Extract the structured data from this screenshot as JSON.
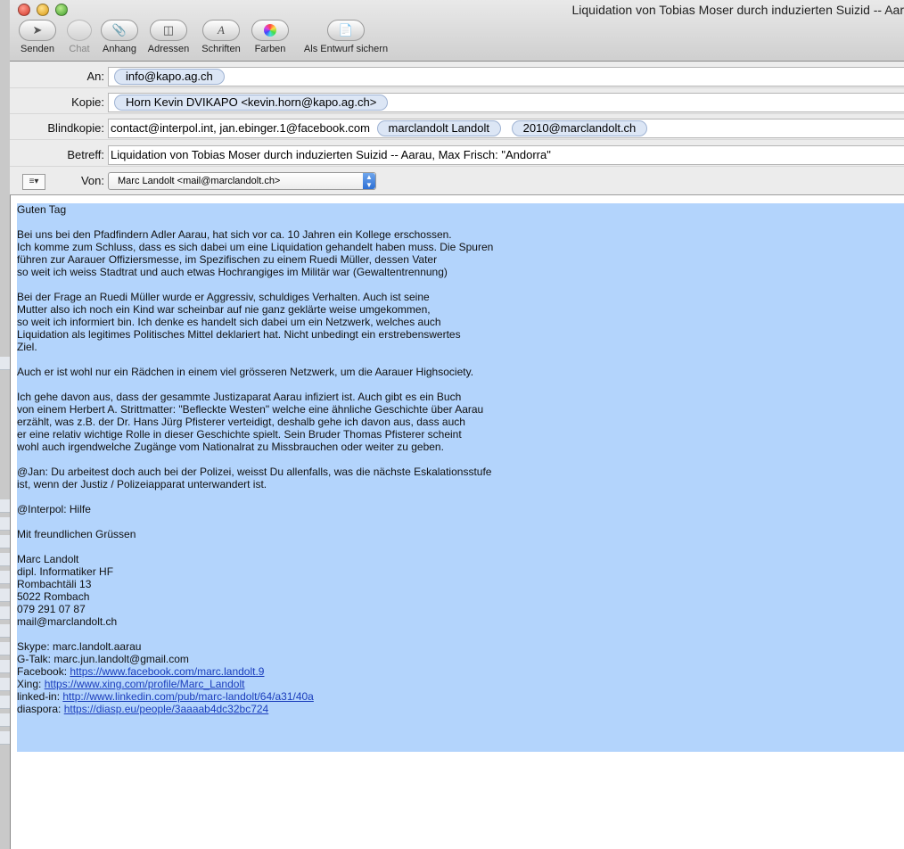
{
  "window": {
    "title": "Liquidation von Tobias Moser durch induzierten Suizid -- Aar"
  },
  "toolbar": {
    "items": [
      {
        "label": "Senden",
        "icon": "send-icon"
      },
      {
        "label": "Chat",
        "icon": "chat-icon"
      },
      {
        "label": "Anhang",
        "icon": "paperclip-icon"
      },
      {
        "label": "Adressen",
        "icon": "address-book-icon"
      },
      {
        "label": "Schriften",
        "icon": "font-icon"
      },
      {
        "label": "Farben",
        "icon": "color-wheel-icon"
      },
      {
        "label": "Als Entwurf sichern",
        "icon": "draft-icon"
      }
    ]
  },
  "header": {
    "an_label": "An:",
    "an_tokens": [
      "info@kapo.ag.ch"
    ],
    "kopie_label": "Kopie:",
    "kopie_tokens": [
      "Horn Kevin DVIKAPO <kevin.horn@kapo.ag.ch>"
    ],
    "blind_label": "Blindkopie:",
    "blind_text": "contact@interpol.int, jan.ebinger.1@facebook.com",
    "blind_tokens": [
      "marclandolt Landolt",
      "2010@marclandolt.ch"
    ],
    "betreff_label": "Betreff:",
    "betreff_value": "Liquidation von Tobias Moser durch induzierten Suizid -- Aarau, Max Frisch: \"Andorra\"",
    "von_label": "Von:",
    "von_menu": "≡▾",
    "von_value": "Marc Landolt <mail@marclandolt.ch>"
  },
  "body": {
    "greeting": "Guten Tag",
    "p1": [
      "Bei uns bei den Pfadfindern Adler Aarau, hat sich vor ca. 10 Jahren ein Kollege erschossen.",
      "Ich komme zum Schluss, dass es sich dabei um eine Liquidation gehandelt haben muss. Die Spuren",
      "führen zur Aarauer Offiziersmesse, im Spezifischen zu einem Ruedi Müller, dessen Vater",
      "so weit ich weiss Stadtrat und auch etwas Hochrangiges im Militär war (Gewaltentrennung)"
    ],
    "p2": [
      "Bei der Frage an Ruedi Müller wurde er Aggressiv, schuldiges Verhalten. Auch ist seine",
      "Mutter also ich noch ein Kind war scheinbar auf nie ganz geklärte weise umgekommen,",
      "so weit ich informiert bin. Ich denke es handelt sich dabei um ein Netzwerk, welches auch",
      "Liquidation als legitimes Politisches Mittel deklariert hat. Nicht unbedingt ein erstrebenswertes",
      "Ziel."
    ],
    "p3": [
      "Auch er ist wohl nur ein Rädchen in einem viel grösseren Netzwerk, um die Aarauer Highsociety."
    ],
    "p4": [
      "Ich gehe davon aus, dass der gesammte Justizaparat Aarau infiziert ist. Auch gibt es ein Buch",
      "von einem Herbert A. Strittmatter: \"Befleckte Westen\" welche eine ähnliche Geschichte über Aarau",
      "erzählt, was z.B. der Dr. Hans Jürg Pfisterer verteidigt, deshalb gehe ich davon aus, dass auch",
      "er eine relativ wichtige Rolle in dieser Geschichte spielt. Sein Bruder Thomas Pfisterer scheint",
      "wohl auch irgendwelche Zugänge vom Nationalrat zu Missbrauchen oder weiter zu geben."
    ],
    "p5": [
      "@Jan: Du arbeitest doch auch bei der Polizei, weisst Du allenfalls, was die nächste Eskalationsstufe",
      "ist, wenn der Justiz / Polizeiapparat unterwandert ist."
    ],
    "p6": [
      "@Interpol: Hilfe"
    ],
    "p7": [
      "Mit freundlichen Grüssen"
    ],
    "signature": [
      "Marc Landolt",
      "dipl. Informatiker HF",
      "Rombachtäli 13",
      "5022 Rombach",
      "079 291 07 87",
      "mail@marclandolt.ch"
    ],
    "contacts": [
      {
        "label": "Skype: ",
        "value": "marc.landolt.aarau",
        "link": false
      },
      {
        "label": "G-Talk: ",
        "value": "marc.jun.landolt@gmail.com",
        "link": false
      },
      {
        "label": "Facebook: ",
        "value": "https://www.facebook.com/marc.landolt.9",
        "link": true
      },
      {
        "label": "Xing: ",
        "value": "https://www.xing.com/profile/Marc_Landolt",
        "link": true
      },
      {
        "label": "linked-in: ",
        "value": "http://www.linkedin.com/pub/marc-landolt/64/a31/40a",
        "link": true
      },
      {
        "label": "diaspora: ",
        "value": "https://diasp.eu/people/3aaaab4dc32bc724",
        "link": true
      }
    ]
  }
}
